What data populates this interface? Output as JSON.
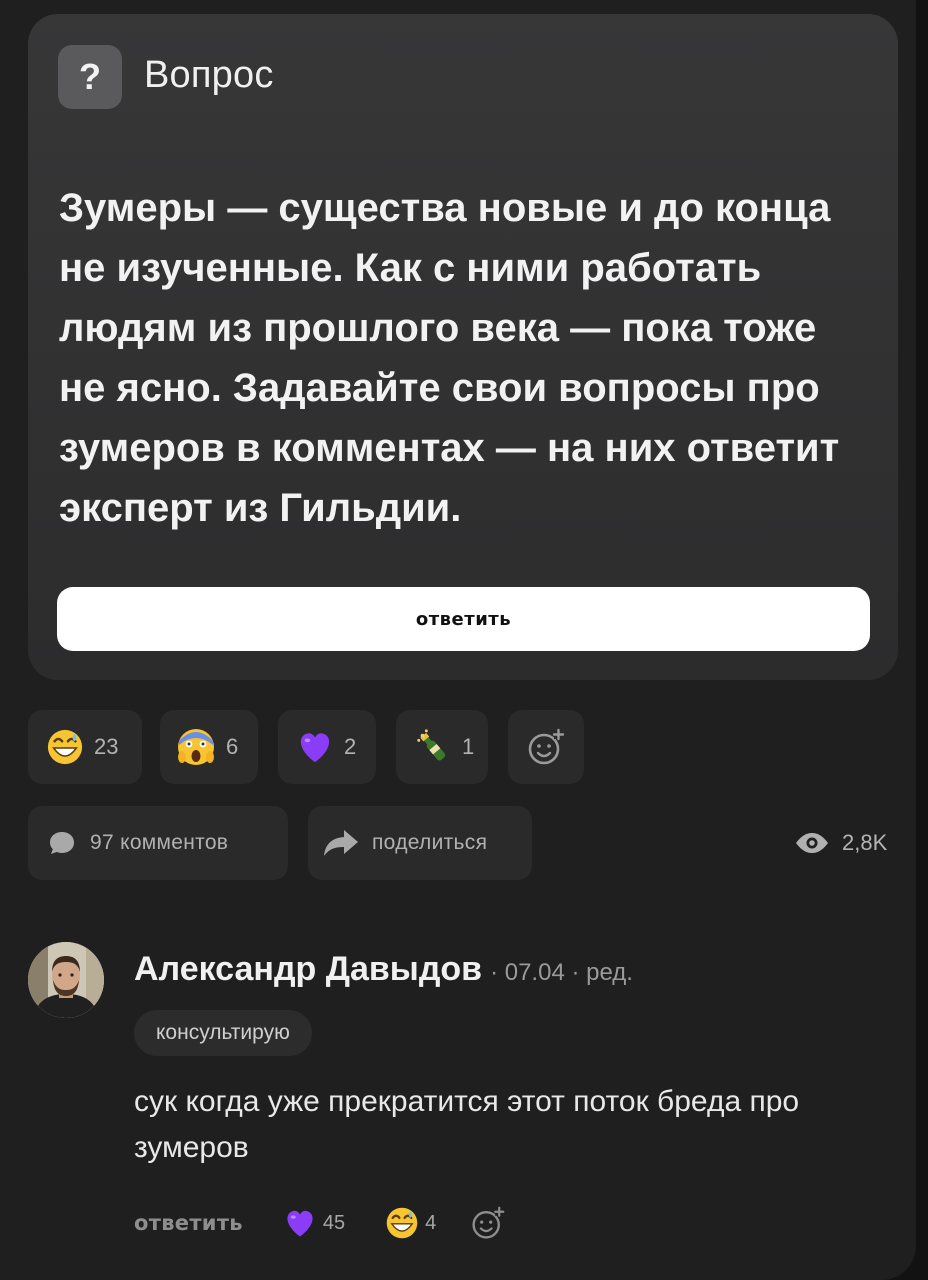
{
  "question": {
    "icon": "question-mark-icon",
    "icon_glyph": "?",
    "title": "Вопрос",
    "text": "Зумеры — существа новые и до конца не изученные. Как с ними работать людям из прошлого века — пока тоже не ясно. Задавайте свои вопросы про зумеров в комментах — на них ответит эксперт из Гильдии.",
    "answer_button": "ответить"
  },
  "reactions": [
    {
      "icon": "grinning-sweat-emoji-icon",
      "count": "23"
    },
    {
      "icon": "screaming-in-fear-emoji-icon",
      "count": "6"
    },
    {
      "icon": "purple-heart-emoji-icon",
      "count": "2"
    },
    {
      "icon": "champagne-bottle-emoji-icon",
      "count": "1"
    },
    {
      "icon": "add-reaction-icon"
    }
  ],
  "actions": {
    "comments_label": "97 комментов",
    "share_label": "поделиться",
    "views": "2,8K"
  },
  "comment": {
    "author": "Александр Давыдов",
    "date": "· 07.04 · ред.",
    "tag": "консультирую",
    "text": "сук когда уже прекратится этот поток бреда про зумеров",
    "reply_label": "ответить",
    "reactions": [
      {
        "icon": "purple-heart-emoji-icon",
        "count": "45"
      },
      {
        "icon": "grinning-sweat-emoji-icon",
        "count": "4"
      },
      {
        "icon": "add-reaction-icon"
      }
    ]
  },
  "colors": {
    "background": "#121212",
    "panel": "#1f1f20",
    "card": "#323233",
    "chip": "#2a2a2b",
    "heart": "#8b3cf7",
    "emoji_yellow": "#f7c531"
  }
}
